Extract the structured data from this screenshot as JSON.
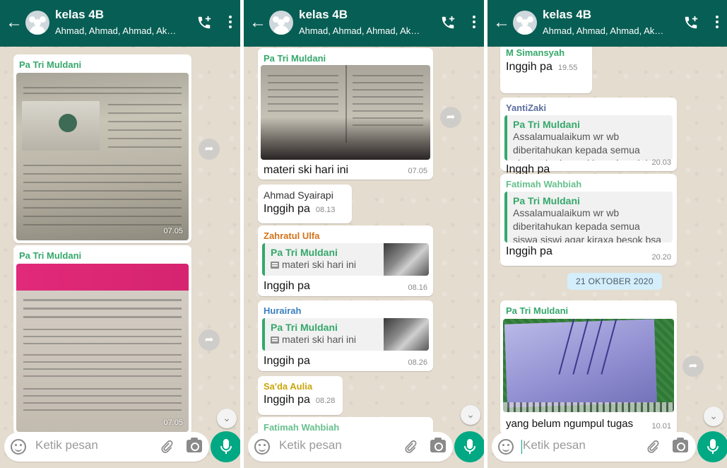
{
  "chat": {
    "title": "kelas 4B",
    "subtitle": "Ahmad, Ahmad, Ahmad, Akbar, B...",
    "input_placeholder": "Ketik pesan"
  },
  "panel1": {
    "m1": {
      "sender": "Pa Tri Muldani",
      "time": "07.05"
    },
    "m2": {
      "sender": "Pa Tri Muldani",
      "time": "07.05"
    }
  },
  "panel2": {
    "m1": {
      "sender": "Pa Tri Muldani",
      "text": "materi ski hari ini",
      "time": "07.05"
    },
    "m2": {
      "sender": "Ahmad Syairapi",
      "text": "Inggih pa",
      "time": "08.13"
    },
    "m3": {
      "sender": "Zahratul Ulfa",
      "quote_name": "Pa Tri Muldani",
      "quote_text": "materi ski hari ini",
      "text": "Inggih pa",
      "time": "08.16"
    },
    "m4": {
      "sender": "Hurairah",
      "quote_name": "Pa Tri Muldani",
      "quote_text": "materi ski hari ini",
      "text": "Inggih pa",
      "time": "08.26"
    },
    "m5": {
      "sender": "Sa'da Aulia",
      "text": "Inggih pa",
      "time": "08.28"
    },
    "m6": {
      "sender": "Fatimah Wahbiah"
    }
  },
  "panel3": {
    "m1": {
      "sender": "M Simansyah",
      "text": "Inggih pa",
      "time": "19.55"
    },
    "m2": {
      "sender": "YantiZaki",
      "quote_name": "Pa Tri Muldani",
      "quote_text": "Assalamualaikum wr wb diberitahukan kepada semua siswa siswi agar kiraxa besok bsa berhadir kesekolah untuk me…",
      "text": "Inggh pa",
      "time": "20.03"
    },
    "m3": {
      "sender": "Fatimah Wahbiah",
      "quote_name": "Pa Tri Muldani",
      "quote_text": "Assalamualaikum wr wb diberitahukan kepada semua siswa siswi agar kiraxa besok bsa berhadir kesekolah untuk me…",
      "text": "Inggih pa",
      "time": "20.20"
    },
    "date": "21 OKTOBER 2020",
    "m4": {
      "sender": "Pa Tri Muldani",
      "text": "yang belum ngumpul tugas",
      "time": "10.01"
    }
  },
  "colors": {
    "header": "#075e54",
    "accent": "#00a884",
    "chip": "#d5eefb"
  }
}
